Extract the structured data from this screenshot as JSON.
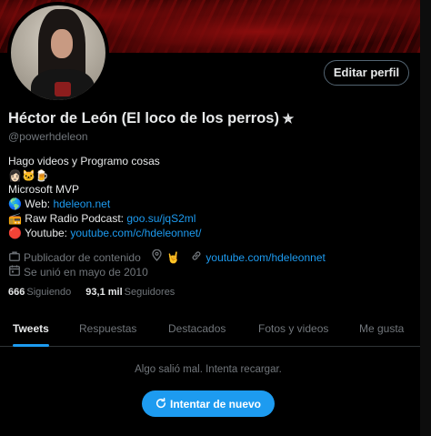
{
  "profile": {
    "name": "Héctor de León (El loco de los perros)",
    "name_icon": "✯",
    "handle": "@powerhdeleon",
    "edit_button": "Editar perfil"
  },
  "bio": {
    "line1": "Hago videos y Programo cosas",
    "emojis": [
      "👩🏻",
      "🐱",
      "🍺"
    ],
    "line3": "Microsoft MVP",
    "web_icon": "🌎",
    "web_label": "Web:",
    "web_link": "hdeleon.net",
    "radio_icon": "📻",
    "radio_label": "Raw Radio Podcast:",
    "radio_link": "goo.su/jqS2ml",
    "yt_icon": "🔴",
    "yt_label": "Youtube:",
    "yt_link": "youtube.com/c/hdeleonnet/"
  },
  "meta": {
    "category": "Publicador de contenido",
    "location_icon": "🤘",
    "link": "youtube.com/hdeleonnet",
    "joined": "Se unió en mayo de 2010"
  },
  "stats": {
    "following_count": "666",
    "following_label": "Siguiendo",
    "followers_count": "93,1 mil",
    "followers_label": "Seguidores"
  },
  "tabs": [
    "Tweets",
    "Respuestas",
    "Destacados",
    "Fotos y videos",
    "Me gusta"
  ],
  "feed": {
    "error_message": "Algo salió mal. Intenta recargar.",
    "retry_button": "Intentar de nuevo"
  },
  "colors": {
    "accent": "#1d9bf0",
    "secondary_text": "#71767b",
    "primary_text": "#e7e9ea",
    "background": "#000000"
  }
}
